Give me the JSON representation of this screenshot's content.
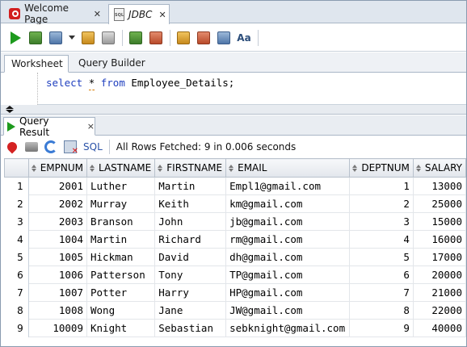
{
  "doc_tabs": [
    {
      "label": "Welcome Page",
      "icon": "oracle-icon"
    },
    {
      "label": "JDBC",
      "icon": "sql-file-icon"
    }
  ],
  "worksheet_tabs": [
    "Worksheet",
    "Query Builder"
  ],
  "editor": {
    "kw_select": "select",
    "star": "*",
    "kw_from": "from",
    "rest": "Employee_Details;"
  },
  "result_tab": {
    "label": "Query Result",
    "close": "×"
  },
  "result_toolbar": {
    "sql_label": "SQL",
    "status": "All Rows Fetched: 9 in 0.006 seconds"
  },
  "table": {
    "columns": [
      "EMPNUM",
      "LASTNAME",
      "FIRSTNAME",
      "EMAIL",
      "DEPTNUM",
      "SALARY"
    ],
    "rows": [
      {
        "n": "1",
        "empnum": "2001",
        "lastname": "Luther",
        "firstname": "Martin",
        "email": "Empl1@gmail.com",
        "deptnum": "1",
        "salary": "13000"
      },
      {
        "n": "2",
        "empnum": "2002",
        "lastname": "Murray",
        "firstname": "Keith",
        "email": "km@gmail.com",
        "deptnum": "2",
        "salary": "25000"
      },
      {
        "n": "3",
        "empnum": "2003",
        "lastname": "Branson",
        "firstname": "John",
        "email": "jb@gmail.com",
        "deptnum": "3",
        "salary": "15000"
      },
      {
        "n": "4",
        "empnum": "1004",
        "lastname": "Martin",
        "firstname": "Richard",
        "email": "rm@gmail.com",
        "deptnum": "4",
        "salary": "16000"
      },
      {
        "n": "5",
        "empnum": "1005",
        "lastname": "Hickman",
        "firstname": "David",
        "email": "dh@gmail.com",
        "deptnum": "5",
        "salary": "17000"
      },
      {
        "n": "6",
        "empnum": "1006",
        "lastname": "Patterson",
        "firstname": "Tony",
        "email": "TP@gmail.com",
        "deptnum": "6",
        "salary": "20000"
      },
      {
        "n": "7",
        "empnum": "1007",
        "lastname": "Potter",
        "firstname": "Harry",
        "email": "HP@gmail.com",
        "deptnum": "7",
        "salary": "21000"
      },
      {
        "n": "8",
        "empnum": "1008",
        "lastname": "Wong",
        "firstname": "Jane",
        "email": "JW@gmail.com",
        "deptnum": "8",
        "salary": "22000"
      },
      {
        "n": "9",
        "empnum": "10009",
        "lastname": "Knight",
        "firstname": "Sebastian",
        "email": "sebknight@gmail.com",
        "deptnum": "9",
        "salary": "40000"
      }
    ]
  },
  "colors": {
    "keyword": "#1f3fbf",
    "run_green": "#1d9a1d",
    "sql_link": "#2a52a8"
  }
}
